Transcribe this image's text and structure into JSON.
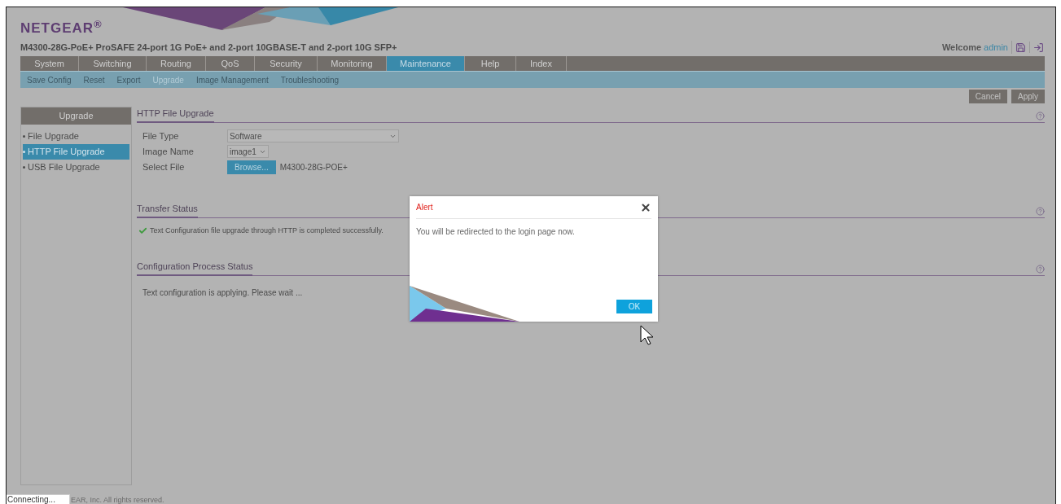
{
  "header": {
    "logo": "NETGEAR$^{®}$",
    "product_title": "M4300-28G-PoE+ ProSAFE 24-port 1G PoE+ and 2-port 10GBASE-T and 2-port 10G SFP+",
    "welcome": "Welcome",
    "user": "admin"
  },
  "nav": [
    {
      "label": "System",
      "selected": false
    },
    {
      "label": "Switching",
      "selected": false
    },
    {
      "label": "Routing",
      "selected": false
    },
    {
      "label": "QoS",
      "selected": false
    },
    {
      "label": "Security",
      "selected": false
    },
    {
      "label": "Monitoring",
      "selected": false
    },
    {
      "label": "Maintenance",
      "selected": true
    },
    {
      "label": "Help",
      "selected": false
    },
    {
      "label": "Index",
      "selected": false
    }
  ],
  "subnav": [
    {
      "label": "Save Config",
      "selected": false
    },
    {
      "label": "Reset",
      "selected": false
    },
    {
      "label": "Export",
      "selected": false
    },
    {
      "label": "Upgrade",
      "selected": true
    },
    {
      "label": "Image Management",
      "selected": false
    },
    {
      "label": "Troubleshooting",
      "selected": false
    }
  ],
  "actions": [
    "Cancel",
    "Apply"
  ],
  "sidebar": {
    "title": "Upgrade",
    "items": [
      {
        "label": "File Upgrade",
        "selected": false
      },
      {
        "label": "HTTP File Upgrade",
        "selected": true
      },
      {
        "label": "USB File Upgrade",
        "selected": false
      }
    ]
  },
  "sections": [
    {
      "title": "HTTP File Upgrade",
      "kind": "form",
      "fields": [
        {
          "label": "File Type",
          "kind": "select",
          "value": "Software"
        },
        {
          "label": "Image Name",
          "kind": "small-select",
          "value": "image1"
        },
        {
          "label": "Select File",
          "kind": "file",
          "button": "Browse...",
          "value": "M4300-28G-POE+"
        }
      ]
    },
    {
      "title": "Transfer Status",
      "kind": "messages",
      "messages": [
        {
          "text": "Text Configuration file upgrade through HTTP is completed successfully.",
          "success": true
        }
      ]
    },
    {
      "title": "Configuration Process Status",
      "kind": "messages",
      "messages": [
        {
          "text": "Text configuration is applying. Please wait ...",
          "success": false
        }
      ]
    }
  ],
  "dialog": {
    "title": "Alert",
    "message": "You will be redirected to the login page now.",
    "button": "OK"
  },
  "status": "Connecting...",
  "footer": "EAR, Inc. All rights reserved."
}
